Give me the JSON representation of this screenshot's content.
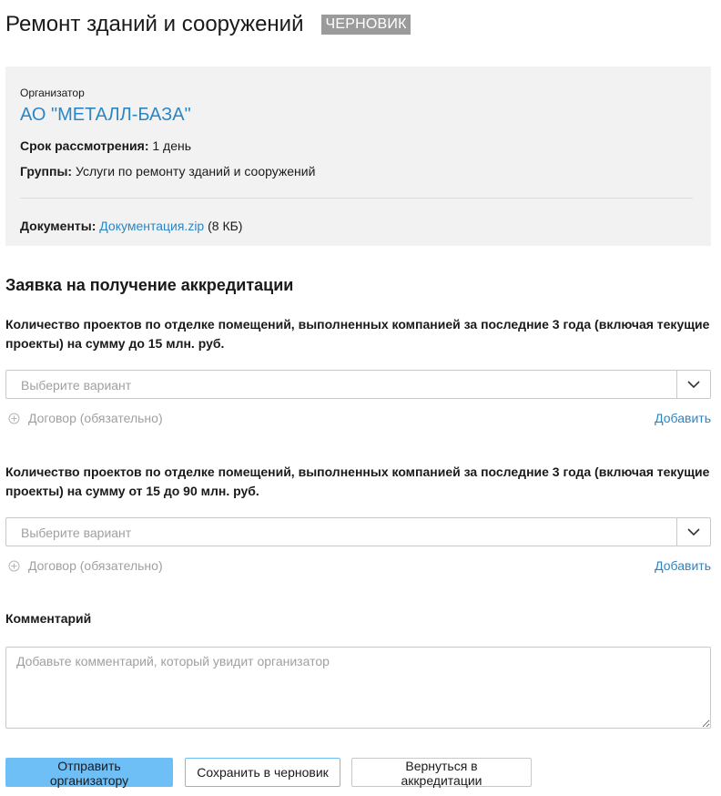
{
  "header": {
    "title": "Ремонт зданий и сооружений",
    "status_badge": "ЧЕРНОВИК"
  },
  "organizer": {
    "caption": "Организатор",
    "name": "АО \"МЕТАЛЛ-БАЗА\"",
    "review_term_label": "Срок рассмотрения:",
    "review_term_value": " 1 день",
    "groups_label": "Группы:",
    "groups_value": " Услуги по ремонту зданий и сооружений",
    "documents_label": "Документы:",
    "document_name": "Документация.zip",
    "document_size": " (8 КБ)"
  },
  "application": {
    "section_title": "Заявка на получение аккредитации",
    "questions": [
      {
        "label": "Количество проектов по отделке помещений, выполненных компанией за последние 3 года (включая текущие проекты) на сумму до 15 млн. руб.",
        "select_placeholder": "Выберите вариант",
        "contract_label": "Договор (обязательно)",
        "add_label": "Добавить"
      },
      {
        "label": "Количество проектов по отделке помещений, выполненных компанией за последние 3 года (включая текущие проекты) на сумму от 15 до 90 млн. руб.",
        "select_placeholder": "Выберите вариант",
        "contract_label": "Договор (обязательно)",
        "add_label": "Добавить"
      }
    ],
    "comment_label": "Комментарий",
    "comment_placeholder": "Добавьте комментарий, который увидит организатор",
    "comment_value": ""
  },
  "actions": {
    "submit_label": "Отправить организатору",
    "save_draft_label": "Сохранить в черновик",
    "back_label": "Вернуться в аккредитации"
  },
  "icons": {
    "select_arrow": "chevron-down-icon",
    "contract_add": "plus-circle-icon"
  },
  "colors": {
    "link": "#2b86c5",
    "badge_bg": "#9b9b9b",
    "card_bg": "#f2f2f2",
    "primary_button": "#6fbff7"
  }
}
